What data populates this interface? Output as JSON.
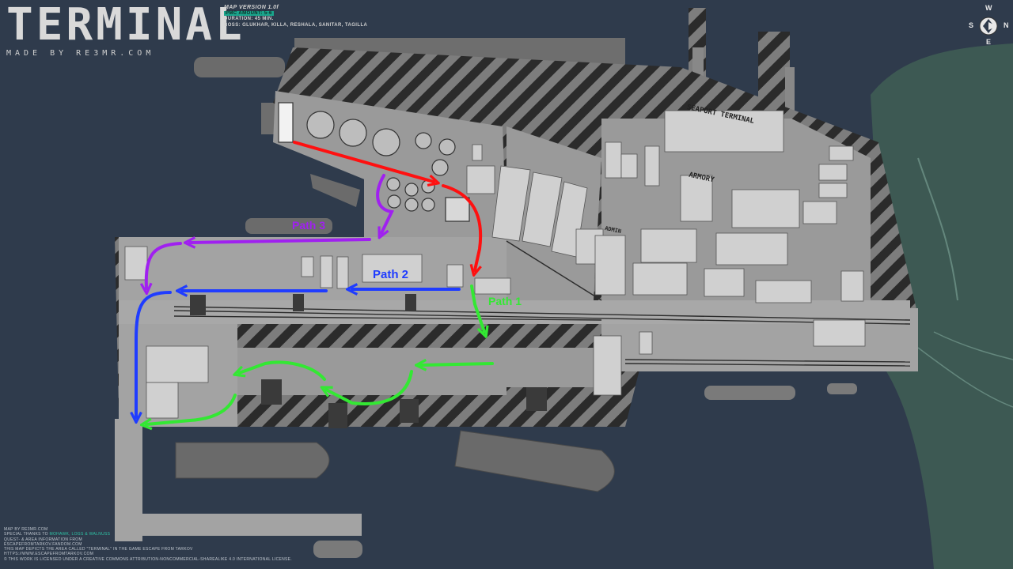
{
  "header": {
    "title": "TERMINAL",
    "made_by": "MADE BY RE3MR.COM",
    "version": "MAP VERSION 1.0f",
    "pmc_amount": "PMC AMOUNT: 5-6",
    "duration": "DURATION: 45 MIN.",
    "boss": "BOSS: GLUKHAR, KILLA, RESHALA, SANITAR, TAGILLA"
  },
  "compass": {
    "n": "W",
    "e": "N",
    "s": "E",
    "w": "S"
  },
  "paths": [
    {
      "label": "Path 1",
      "color": "#33e833"
    },
    {
      "label": "Path 2",
      "color": "#1f3cff"
    },
    {
      "label": "Path 3",
      "color": "#a020f0"
    },
    {
      "label": "",
      "color": "#ff1010"
    }
  ],
  "buildings": {
    "seaport_terminal": "SEAPORT TERMINAL",
    "armory": "ARMORY",
    "admin": "ADMIN"
  },
  "footer": {
    "line1": "MAP BY RE3MR.COM",
    "line2_prefix": "SPECIAL THANKS TO",
    "line2_names": "MOHAWK, LOGS & WALNUSS",
    "line3": "QUEST- & AREA INFORMATION FROM",
    "line4": "ESCAPEFROMTARKOV.FANDOM.COM",
    "line5": "THIS MAP DEPICTS THE AREA CALLED \"TERMINAL\" IN THE GAME ESCAPE FROM TARKOV",
    "line6": "HTTPS://WWW.ESCAPEFROMTARKOV.COM",
    "line7": "© THIS WORK IS LICENSED UNDER A CREATIVE COMMONS ATTRIBUTION-NONCOMMERCIAL-SHAREALIKE 4.0 INTERNATIONAL LICENSE."
  }
}
